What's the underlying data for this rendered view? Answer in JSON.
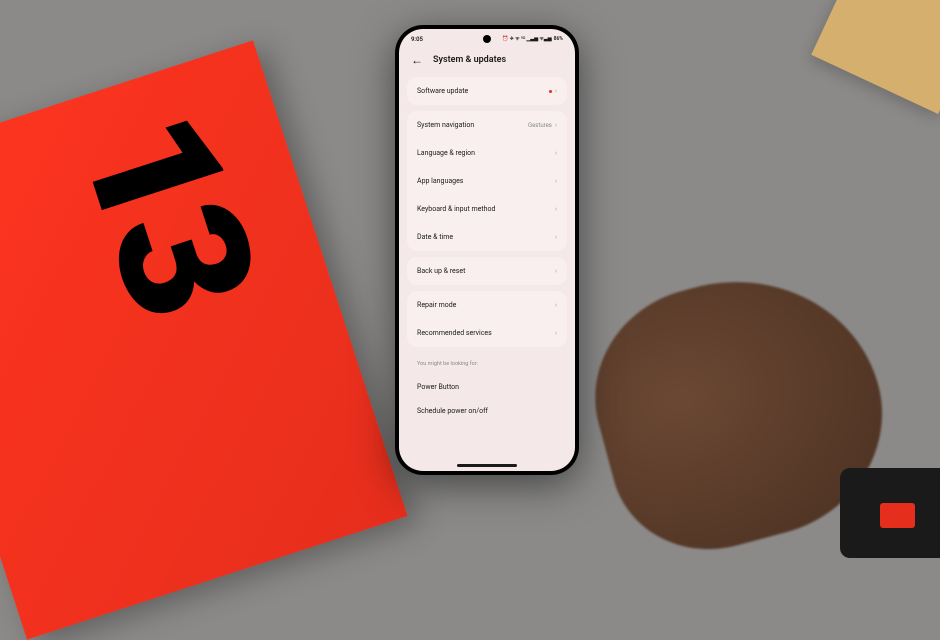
{
  "status": {
    "time": "9:05",
    "icons": "⏰ ✈ ᯤ ⁵ᴳ ▁▃▅  ᯤ▃▅",
    "battery": "86%"
  },
  "header": {
    "title": "System & updates"
  },
  "groups": [
    {
      "rows": [
        {
          "label": "Software update",
          "value": "",
          "dot": true
        }
      ]
    },
    {
      "rows": [
        {
          "label": "System navigation",
          "value": "Gestures",
          "dot": false
        },
        {
          "label": "Language & region",
          "value": "",
          "dot": false
        },
        {
          "label": "App languages",
          "value": "",
          "dot": false
        },
        {
          "label": "Keyboard & input method",
          "value": "",
          "dot": false
        },
        {
          "label": "Date & time",
          "value": "",
          "dot": false
        }
      ]
    },
    {
      "rows": [
        {
          "label": "Back up & reset",
          "value": "",
          "dot": false
        }
      ]
    },
    {
      "rows": [
        {
          "label": "Repair mode",
          "value": "",
          "dot": false
        },
        {
          "label": "Recommended services",
          "value": "",
          "dot": false
        }
      ]
    }
  ],
  "hints": {
    "label": "You might be looking for:",
    "items": [
      "Power Button",
      "Schedule power on/off"
    ]
  }
}
